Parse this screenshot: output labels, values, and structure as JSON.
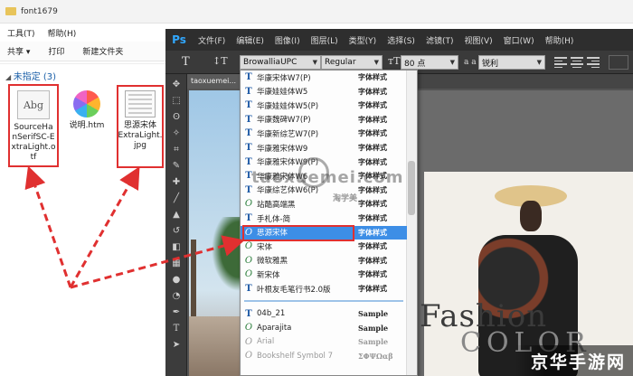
{
  "explorer": {
    "title": "font1679",
    "menu": [
      "工具(T)",
      "帮助(H)"
    ],
    "toolbar": [
      "共享 ▾",
      "打印",
      "新建文件夹"
    ],
    "group_label": "未指定 (3)",
    "files": [
      {
        "name": "SourceHanSerifSC-ExtraLight.otf",
        "lines": [
          "SourceHa",
          "nSerifSC-E",
          "xtraLight.o",
          "tf"
        ],
        "icon_text": "Abg"
      },
      {
        "name": "说明.htm",
        "lines": [
          "说明.htm"
        ]
      },
      {
        "name": "思源宋体ExtraLight.jpg",
        "lines": [
          "思源宋体",
          "ExtraLight.",
          "jpg"
        ]
      }
    ]
  },
  "photoshop": {
    "logo": "Ps",
    "menu": [
      "文件(F)",
      "编辑(E)",
      "图像(I)",
      "图层(L)",
      "类型(Y)",
      "选择(S)",
      "滤镜(T)",
      "视图(V)",
      "窗口(W)",
      "帮助(H)"
    ],
    "options": {
      "font_family": "BrowalliaUPC",
      "font_style": "Regular",
      "font_size": "80 点",
      "aa_label": "a a",
      "antialias": "锐利"
    },
    "doc_tab": "taoxuemei...",
    "canvas_text": {
      "line1": "Fashion",
      "line2": "COLOR"
    }
  },
  "font_list": {
    "items": [
      {
        "icon": "T",
        "name": "华康宋体W7(P)",
        "sample": "字体样式"
      },
      {
        "icon": "T",
        "name": "华康娃娃体W5",
        "sample": "字体样式"
      },
      {
        "icon": "T",
        "name": "华康娃娃体W5(P)",
        "sample": "字体样式"
      },
      {
        "icon": "T",
        "name": "华康魏碑W7(P)",
        "sample": "字体样式"
      },
      {
        "icon": "T",
        "name": "华康新综艺W7(P)",
        "sample": "字体样式"
      },
      {
        "icon": "T",
        "name": "华康雅宋体W9",
        "sample": "字体样式"
      },
      {
        "icon": "T",
        "name": "华康雅宋体W9(P)",
        "sample": "字体样式"
      },
      {
        "icon": "T",
        "name": "华康雅宋体W6",
        "sample": "字体样式"
      },
      {
        "icon": "T",
        "name": "华康综艺体W6(P)",
        "sample": "字体样式"
      },
      {
        "icon": "O",
        "name": "站酷高端黑",
        "sample": "字体样式"
      },
      {
        "icon": "T",
        "name": "手札体-简",
        "sample": "字体样式"
      },
      {
        "icon": "O",
        "name": "思源宋体",
        "sample": "字体样式",
        "selected": true
      },
      {
        "icon": "O",
        "name": "宋体",
        "sample": "字体样式"
      },
      {
        "icon": "O",
        "name": "微软雅黑",
        "sample": "字体样式"
      },
      {
        "icon": "O",
        "name": "新宋体",
        "sample": "字体样式"
      },
      {
        "icon": "T",
        "name": "叶根友毛笔行书2.0版",
        "sample": "字体样式"
      },
      {
        "icon": "T",
        "name": "04b_21",
        "sample": "Sample"
      },
      {
        "icon": "O",
        "name": "Aparajita",
        "sample": "Sample"
      },
      {
        "icon": "O",
        "name": "Arial",
        "sample": "Sample",
        "gray": true
      },
      {
        "icon": "O",
        "name": "Bookshelf Symbol 7",
        "sample": "ΣΦΨΩαβ",
        "gray": true
      }
    ]
  },
  "watermark": {
    "site": "taoxuemei.com",
    "cn": "淘学美",
    "corner": "京华手游网"
  },
  "colors": {
    "ps_menu_bg": "#2e2e2e",
    "ps_logo": "#31a8ff",
    "annotation_red": "#e03030",
    "selection_blue": "#3d8ee6"
  }
}
